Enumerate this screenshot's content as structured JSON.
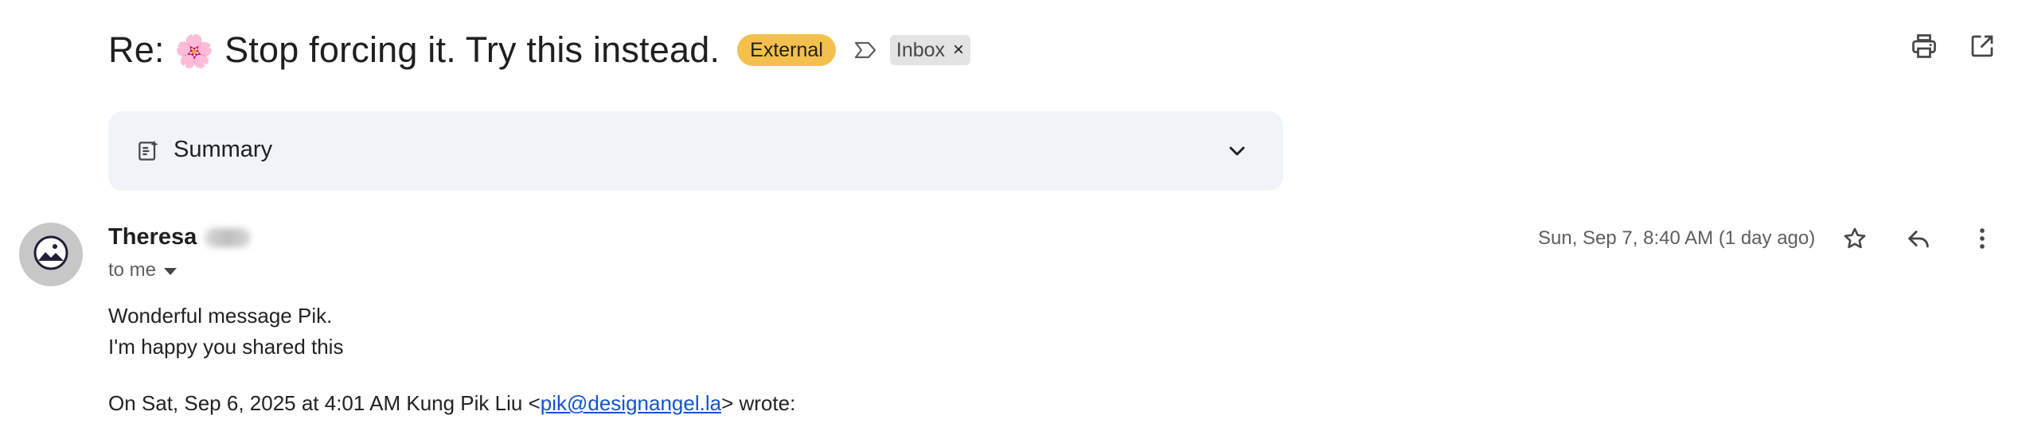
{
  "subject": {
    "prefix": "Re:",
    "emoji": "🌸",
    "text": "Stop forcing it. Try this instead.",
    "external_badge": "External",
    "label": "Inbox",
    "label_close": "×"
  },
  "top_actions": {
    "print_icon": "print-icon",
    "popout_icon": "open-in-new-window-icon"
  },
  "summary": {
    "label": "Summary",
    "icon": "summary-sparkle-icon",
    "chevron": "chevron-down-icon"
  },
  "message": {
    "sender_first_name": "Theresa",
    "recipient_label": "to me",
    "date": "Sun, Sep 7, 8:40 AM (1 day ago)",
    "body_lines": [
      "Wonderful message Pik.",
      "I'm happy you shared this"
    ],
    "quote_prefix": "On Sat, Sep 6, 2025 at 4:01 AM Kung Pik Liu <",
    "quote_email": "pik@designangel.la",
    "quote_suffix": "> wrote:"
  },
  "colors": {
    "external_badge": "#f4c04d",
    "summary_bg": "#f0f4f9",
    "link": "#1155cc",
    "avatar_bg": "#c7c7c7"
  }
}
